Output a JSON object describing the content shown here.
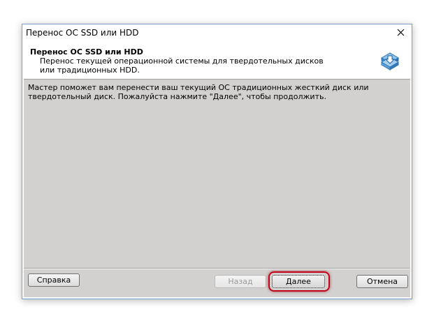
{
  "window": {
    "title": "Перенос ОС SSD или HDD"
  },
  "header": {
    "title": "Перенос ОС SSD или HDD",
    "description": "Перенос текущей операционной системы для твердотельных дисков или традиционных HDD.",
    "icon": "disk-migration-icon"
  },
  "content": {
    "intro": "Мастер поможет вам перенести ваш текущий ОС традиционных жесткий диск или твердотельный диск. Пожалуйста нажмите \"Далее\", чтобы продолжить."
  },
  "buttons": {
    "help": "Справка",
    "back": "Назад",
    "next": "Далее",
    "cancel": "Отмена"
  },
  "colors": {
    "content_bg": "#d3d1cf",
    "highlight": "#c4001a",
    "window_border": "#7a9cc6"
  }
}
